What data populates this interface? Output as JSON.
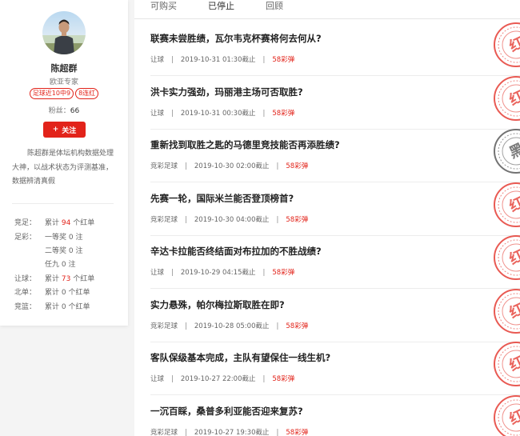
{
  "profile": {
    "name": "陈超群",
    "title": "欧亚专家",
    "tags": [
      "足球近10中9",
      "8连红"
    ],
    "fans_label": "粉丝：",
    "fans_count": "66",
    "follow_label": "关注",
    "bio": "陈超群是体坛机构数据处理大神，以战术状态为评测基准，数据辨清真假",
    "stats": [
      {
        "label": "竞足：",
        "prefix": "累计 ",
        "value": "94",
        "suffix": " 个红单",
        "highlight": true
      },
      {
        "label": "足彩：",
        "prefix": "一等奖 ",
        "value": "0",
        "suffix": " 注",
        "highlight": false
      },
      {
        "label": "",
        "prefix": "二等奖 ",
        "value": "0",
        "suffix": " 注",
        "highlight": false
      },
      {
        "label": "",
        "prefix": "任九 ",
        "value": "0",
        "suffix": " 注",
        "highlight": false
      },
      {
        "label": "让球：",
        "prefix": "累计 ",
        "value": "73",
        "suffix": " 个红单",
        "highlight": true
      },
      {
        "label": "北单：",
        "prefix": "累计 ",
        "value": "0",
        "suffix": " 个红单",
        "highlight": false
      },
      {
        "label": "竞篮：",
        "prefix": "累计 ",
        "value": "0",
        "suffix": " 个红单",
        "highlight": false
      }
    ]
  },
  "tabs": [
    {
      "label": "可购买",
      "active": false
    },
    {
      "label": "已停止",
      "active": true
    },
    {
      "label": "回顾",
      "active": false
    }
  ],
  "articles": [
    {
      "title": "联赛未尝胜绩，瓦尔韦克杯赛将何去何从?",
      "category": "让球",
      "time": "2019-10-31 01:30截止",
      "price": "58彩弹",
      "result": "红",
      "result_color": "#e2231a"
    },
    {
      "title": "洪卡实力强劲，玛丽港主场可否取胜?",
      "category": "让球",
      "time": "2019-10-31 00:30截止",
      "price": "58彩弹",
      "result": "红",
      "result_color": "#e2231a"
    },
    {
      "title": "重新找到取胜之匙的马德里竞技能否再添胜绩?",
      "category": "竞彩足球",
      "time": "2019-10-30 02:00截止",
      "price": "58彩弹",
      "result": "黑",
      "result_color": "#444444"
    },
    {
      "title": "先赛一轮，国际米兰能否登顶榜首?",
      "category": "竞彩足球",
      "time": "2019-10-30 04:00截止",
      "price": "58彩弹",
      "result": "红",
      "result_color": "#e2231a"
    },
    {
      "title": "辛达卡拉能否终结面对布拉加的不胜战绩?",
      "category": "让球",
      "time": "2019-10-29 04:15截止",
      "price": "58彩弹",
      "result": "红",
      "result_color": "#e2231a"
    },
    {
      "title": "实力悬殊，帕尔梅拉斯取胜在即?",
      "category": "竞彩足球",
      "time": "2019-10-28 05:00截止",
      "price": "58彩弹",
      "result": "红",
      "result_color": "#e2231a"
    },
    {
      "title": "客队保级基本完成，主队有望保住一线生机?",
      "category": "让球",
      "time": "2019-10-27 22:00截止",
      "price": "58彩弹",
      "result": "红",
      "result_color": "#e2231a"
    },
    {
      "title": "一沉百睬，桑普多利亚能否迎来复苏?",
      "category": "竞彩足球",
      "time": "2019-10-27 19:30截止",
      "price": "58彩弹",
      "result": "红",
      "result_color": "#e2231a"
    }
  ]
}
